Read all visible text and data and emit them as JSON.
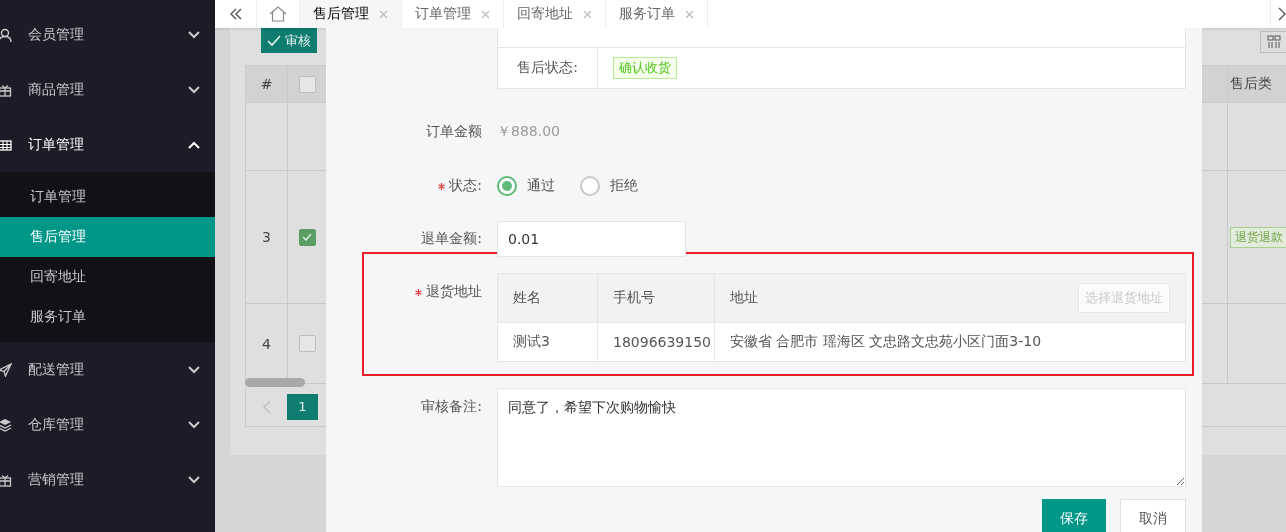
{
  "sidebar": {
    "menu": [
      {
        "label": "会员管理",
        "expanded": false
      },
      {
        "label": "商品管理",
        "expanded": false
      },
      {
        "label": "订单管理",
        "expanded": true,
        "children": [
          {
            "label": "订单管理",
            "selected": false
          },
          {
            "label": "售后管理",
            "selected": true
          },
          {
            "label": "回寄地址",
            "selected": false
          },
          {
            "label": "服务订单",
            "selected": false
          }
        ]
      },
      {
        "label": "配送管理",
        "expanded": false
      },
      {
        "label": "仓库管理",
        "expanded": false
      },
      {
        "label": "营销管理",
        "expanded": false
      }
    ]
  },
  "tabs": [
    {
      "label": "售后管理",
      "selected": true
    },
    {
      "label": "订单管理",
      "selected": false
    },
    {
      "label": "回寄地址",
      "selected": false
    },
    {
      "label": "服务订单",
      "selected": false
    }
  ],
  "list_page": {
    "audit_button": "审核",
    "table": {
      "index_header": "#",
      "header_checked": false,
      "last_column": "售后类",
      "rows": [
        {
          "index": "3",
          "checked": true,
          "tag": "退货退款"
        },
        {
          "index": "4",
          "checked": false
        }
      ]
    },
    "pagination": {
      "pages": [
        {
          "label": "1",
          "selected": true
        }
      ]
    }
  },
  "modal": {
    "detail_rows": [
      {
        "label": "售后状态:",
        "tag": "确认收货"
      }
    ],
    "order_amount": {
      "label": "订单金额",
      "value": "￥888.00"
    },
    "status": {
      "label": "状态:",
      "required": true,
      "options": [
        {
          "label": "通过",
          "selected": true
        },
        {
          "label": "拒绝",
          "selected": false
        }
      ]
    },
    "refund_amount": {
      "label": "退单金额:",
      "value": "0.01"
    },
    "return_address": {
      "label": "退货地址",
      "required": true,
      "highlighted": true,
      "columns": [
        "姓名",
        "手机号",
        "地址"
      ],
      "select_button": "选择退货地址",
      "rows": [
        {
          "cells": [
            "测试3",
            "18096639150",
            "安徽省 合肥市 瑶海区 文忠路文忠苑小区门面3-10"
          ]
        }
      ]
    },
    "remark": {
      "label": "审核备注:",
      "value": "同意了，希望下次购物愉快"
    },
    "buttons": [
      {
        "label": "保存",
        "kind": "primary"
      },
      {
        "label": "取消",
        "kind": "default"
      }
    ]
  }
}
